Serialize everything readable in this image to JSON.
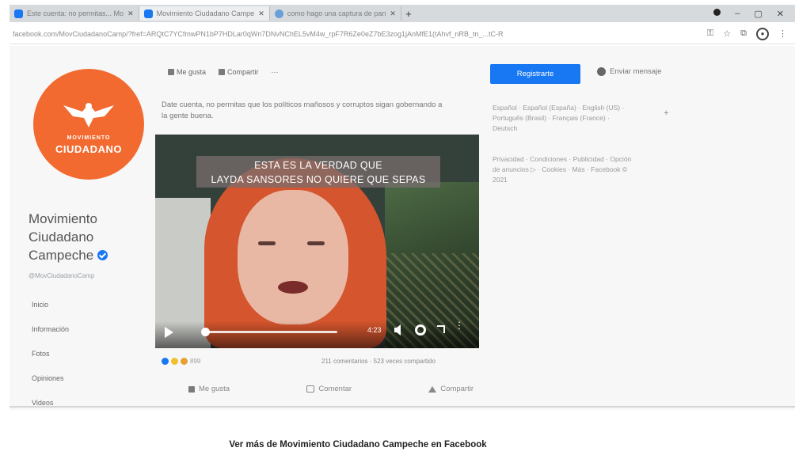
{
  "browser": {
    "tabs": [
      {
        "title": "Este cuenta: no permitas... Mo",
        "active": false
      },
      {
        "title": "Movimiento Ciudadano Campe",
        "active": true
      },
      {
        "title": "como hago una captura de pan",
        "active": false
      }
    ],
    "newtab_label": "+",
    "url": "facebook.com/MovCiudadanoCamp/?fref=ARQtC7YCfmwPN1bP7HDLar0qWn7DNvNChEL5vM4w_rpF7R6Ze0eZ7bE3zog1jAnMfE1(tAhvf_nRB_tn_...tC-R"
  },
  "sidebar": {
    "avatar_small_text": "MOVIMIENTO",
    "avatar_big_text": "CIUDADANO",
    "page_name": "Movimiento Ciudadano Campeche",
    "handle": "@MovCiudadanoCamp",
    "nav": [
      "Inicio",
      "Información",
      "Fotos",
      "Opiniones",
      "Videos"
    ]
  },
  "post": {
    "actions_top": {
      "like": "Me gusta",
      "share": "Compartir",
      "more": "···"
    },
    "text": "Date cuenta, no permitas que los políticos mañosos y corruptos sigan gobernando a la gente buena.",
    "video": {
      "banner_line1": "ESTA ES LA VERDAD QUE",
      "banner_line2": "LAYDA SANSORES NO QUIERE QUE SEPAS",
      "time": "4:23",
      "progress": 0.02
    },
    "reaction_count": "899",
    "counts_text": "211 comentarios · 523 veces compartido",
    "actions": {
      "like": "Me gusta",
      "comment": "Comentar",
      "share": "Compartir"
    }
  },
  "right": {
    "register_button": "Registrarte",
    "message_button": "Enviar mensaje",
    "languages": "Español · Español (España) · English (US) · Português (Brasil) · Français (France) · Deutsch",
    "plus": "+",
    "footer": "Privacidad · Condiciones · Publicidad · Opción de anuncios ▷ · Cookies · Más · Facebook © 2021"
  },
  "cta": "Ver más de Movimiento Ciudadano Campeche en Facebook",
  "colors": {
    "brand_orange": "#f26a2f",
    "facebook_blue": "#1877f2"
  }
}
